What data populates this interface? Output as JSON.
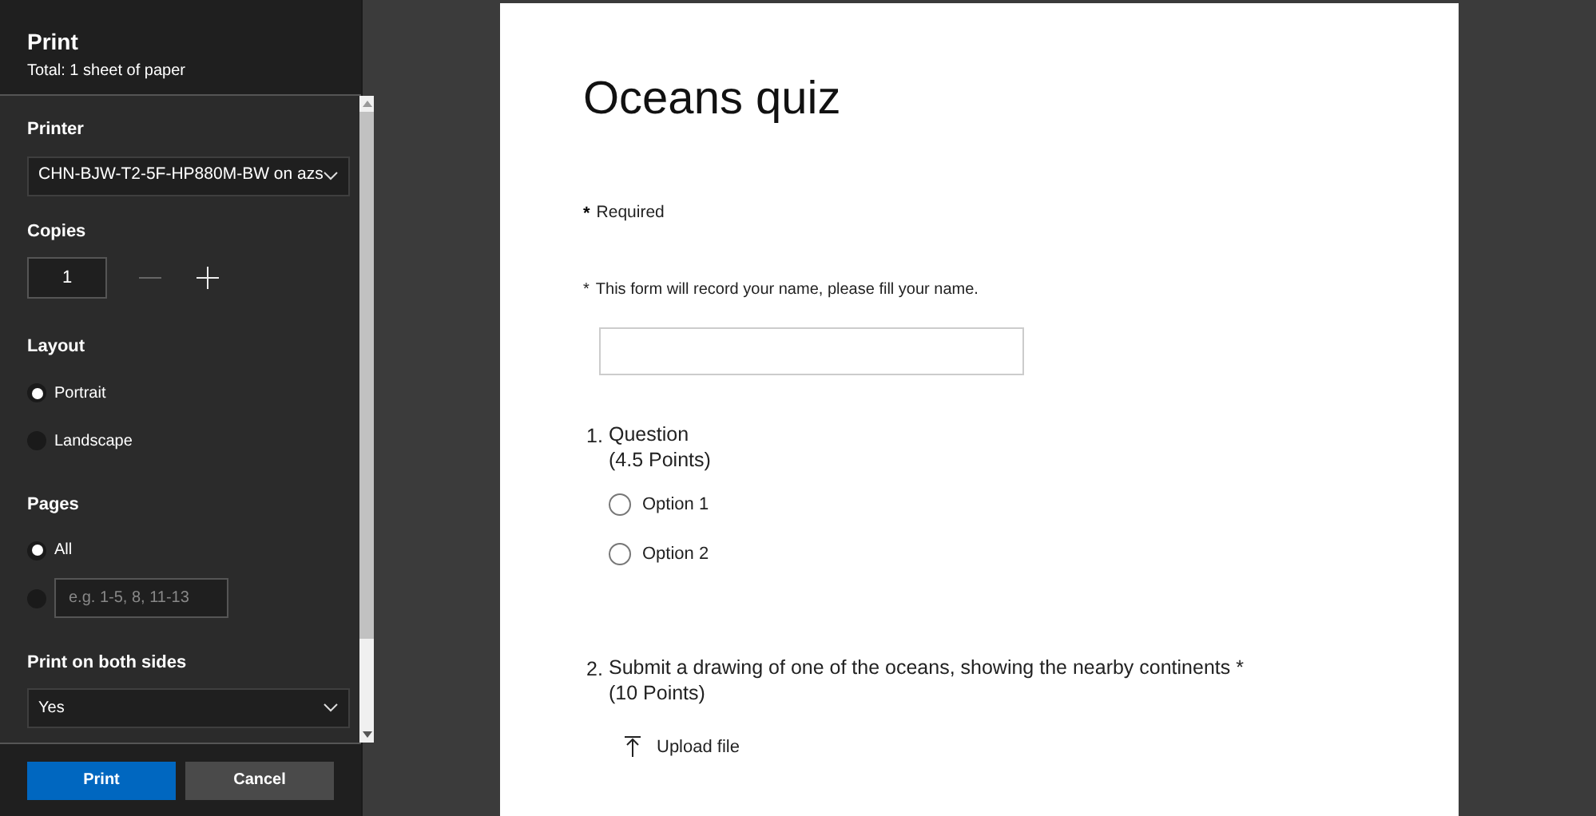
{
  "print_panel": {
    "title": "Print",
    "subtitle": "Total: 1 sheet of paper",
    "printer": {
      "label": "Printer",
      "value": "CHN-BJW-T2-5F-HP880M-BW on azs"
    },
    "copies": {
      "label": "Copies",
      "value": "1",
      "decrease_disabled": true
    },
    "layout": {
      "label": "Layout",
      "options": [
        {
          "label": "Portrait",
          "selected": true
        },
        {
          "label": "Landscape",
          "selected": false
        }
      ]
    },
    "pages": {
      "label": "Pages",
      "options": [
        {
          "kind": "label",
          "label": "All",
          "selected": true
        },
        {
          "kind": "field",
          "placeholder": "e.g. 1-5, 8, 11-13",
          "selected": false
        }
      ]
    },
    "duplex": {
      "label": "Print on both sides",
      "value": "Yes"
    },
    "buttons": [
      {
        "label": "Print",
        "kind": "primary"
      },
      {
        "label": "Cancel",
        "kind": "secondary"
      }
    ]
  },
  "preview": {
    "title": "Oceans quiz",
    "required_mark": "*",
    "required_note": "Required",
    "name_note_mark": "*",
    "name_note": "This form will record your name, please fill your name.",
    "questions": [
      {
        "number": "1.",
        "title": "Question",
        "points": "(4.5 Points)",
        "kind": "choice",
        "options": [
          {
            "label": "Option 1",
            "selected": false
          },
          {
            "label": "Option 2",
            "selected": false
          }
        ]
      },
      {
        "number": "2.",
        "title": "Submit a drawing of one of the oceans, showing the nearby continents *",
        "points": "(10 Points)",
        "kind": "upload",
        "upload_label": "Upload file"
      }
    ]
  }
}
